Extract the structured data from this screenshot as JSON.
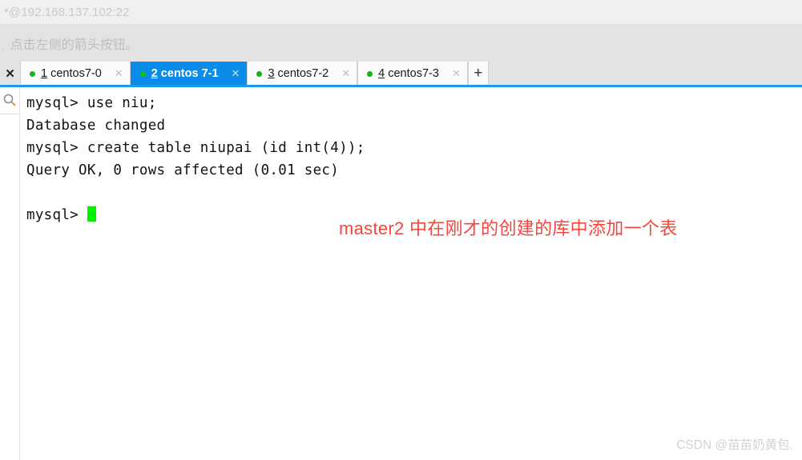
{
  "window": {
    "title": "*@192.168.137.102:22"
  },
  "hint": {
    "stub": ",",
    "text": "点击左侧的箭头按钮。"
  },
  "tabbar": {
    "close_all_label": "✕",
    "add_tab_label": "+",
    "close_glyph": "✕",
    "tabs": [
      {
        "num": "1",
        "name": " centos7-0",
        "active": false,
        "status": "connected"
      },
      {
        "num": "2",
        "name": " centos 7-1",
        "active": true,
        "status": "connected"
      },
      {
        "num": "3",
        "name": " centos7-2",
        "active": false,
        "status": "connected"
      },
      {
        "num": "4",
        "name": " centos7-3",
        "active": false,
        "status": "connected"
      }
    ]
  },
  "sidebar": {
    "search_icon_name": "search-icon"
  },
  "terminal": {
    "lines": [
      "mysql> use niu;",
      "Database changed",
      "mysql> create table niupai (id int(4));",
      "Query OK, 0 rows affected (0.01 sec)",
      "",
      "mysql> "
    ],
    "cursor_color": "#00f000",
    "prompt": "mysql>"
  },
  "annotation": {
    "text": "master2 中在刚才的创建的库中添加一个表",
    "color": "#f5463c"
  },
  "watermark": {
    "text": "CSDN @苗苗奶黄包."
  },
  "colors": {
    "active_tab": "#0c8ce9",
    "blue_rule": "#1a9ae8",
    "status_dot": "#17b317",
    "chrome": "#e3e3e3"
  }
}
